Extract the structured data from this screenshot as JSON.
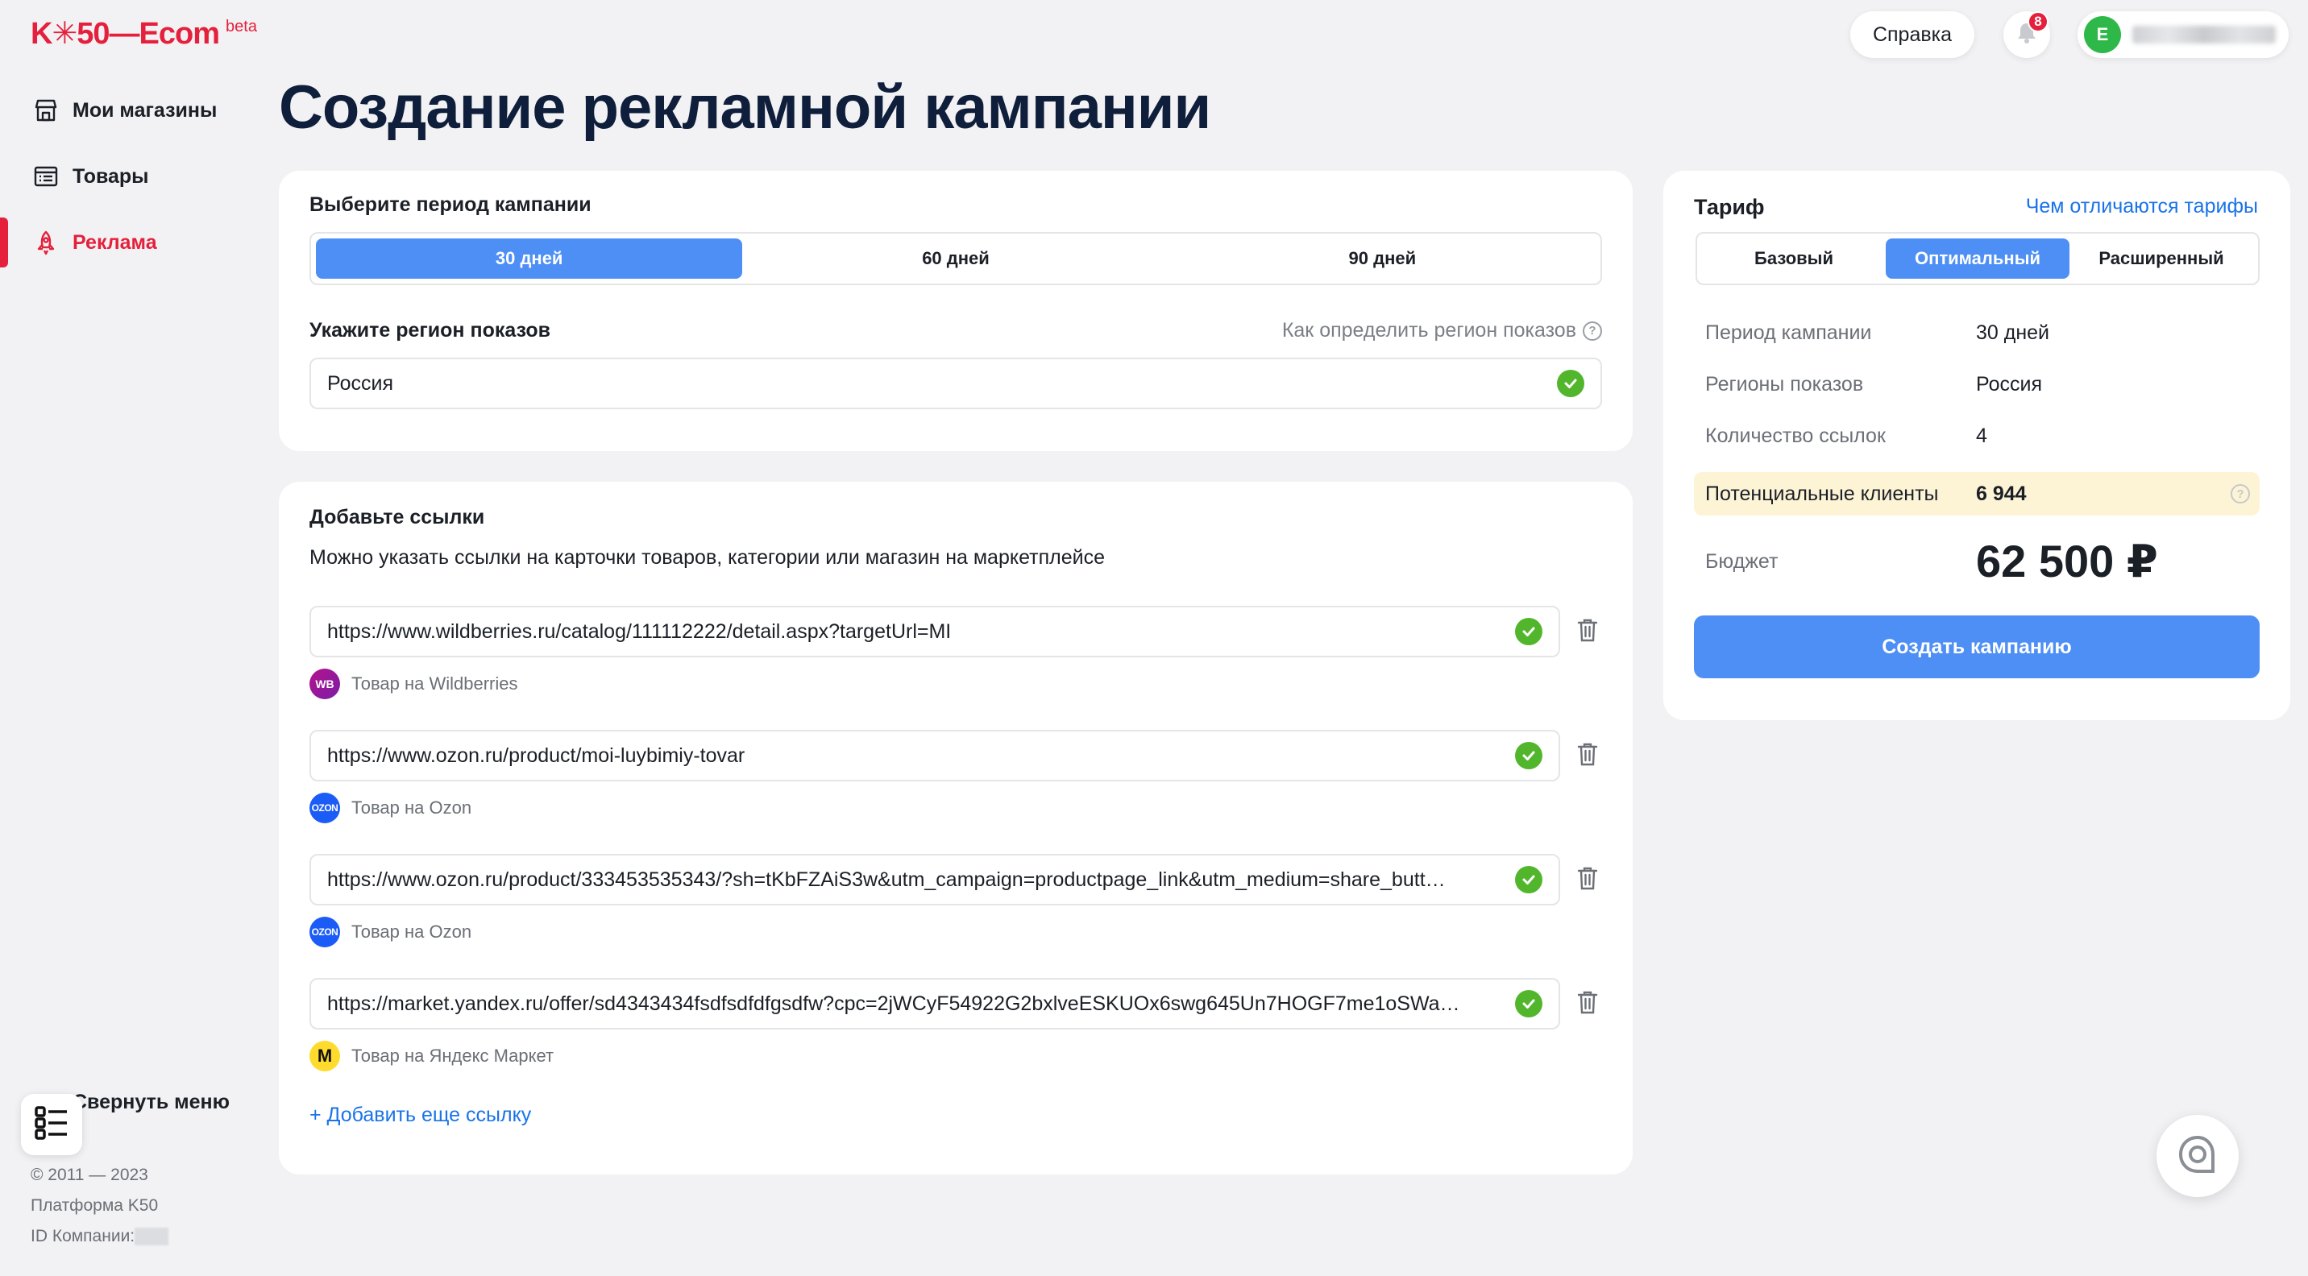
{
  "app": {
    "logo": "K✳50—Ecom",
    "beta": "beta"
  },
  "sidebar": {
    "items": [
      {
        "label": "Мои магазины",
        "icon": "store-icon"
      },
      {
        "label": "Товары",
        "icon": "list-icon"
      },
      {
        "label": "Реклама",
        "icon": "rocket-icon",
        "active": true
      }
    ],
    "collapse_label": "Свернуть меню",
    "footer": {
      "copyright": "© 2011 — 2023",
      "platform": "Платформа K50",
      "company_id_label": "ID Компании:"
    }
  },
  "header": {
    "help_label": "Справка",
    "notifications_count": "8",
    "avatar_letter": "E"
  },
  "page_title": "Создание рекламной кампании",
  "period": {
    "title": "Выберите период кампании",
    "options": [
      "30 дней",
      "60 дней",
      "90 дней"
    ],
    "selected": "30 дней"
  },
  "region": {
    "title": "Укажите регион показов",
    "help_link": "Как определить регион показов",
    "value": "Россия"
  },
  "links": {
    "title": "Добавьте ссылки",
    "description": "Можно указать ссылки на карточки товаров, категории или магазин на маркетплейсе",
    "items": [
      {
        "url": "https://www.wildberries.ru/catalog/111112222/detail.aspx?targetUrl=MI",
        "marketplace": "Товар на Wildberries",
        "logo": "WB"
      },
      {
        "url": "https://www.ozon.ru/product/moi-luybimiy-tovar",
        "marketplace": "Товар на Ozon",
        "logo": "OZON"
      },
      {
        "url": "https://www.ozon.ru/product/333453535343/?sh=tKbFZAiS3w&utm_campaign=productpage_link&utm_medium=share_butt…",
        "marketplace": "Товар на Ozon",
        "logo": "OZON"
      },
      {
        "url": "https://market.yandex.ru/offer/sd4343434fsdfsdfdfgsdfw?cpc=2jWCyF54922G2bxlveESKUOx6swg645Un7HOGF7me1oSWa…",
        "marketplace": "Товар на Яндекс Маркет",
        "logo": "M"
      }
    ],
    "add_label": "+ Добавить еще ссылку"
  },
  "tariff": {
    "title": "Тариф",
    "diff_link": "Чем отличаются тарифы",
    "options": [
      "Базовый",
      "Оптимальный",
      "Расширенный"
    ],
    "selected": "Оптимальный",
    "summary": {
      "period_label": "Период кампании",
      "period_value": "30 дней",
      "regions_label": "Регионы показов",
      "regions_value": "Россия",
      "links_label": "Количество ссылок",
      "links_value": "4",
      "clients_label": "Потенциальные клиенты",
      "clients_value": "6 944",
      "budget_label": "Бюджет",
      "budget_value": "62 500 ₽"
    },
    "create_label": "Создать кампанию"
  },
  "colors": {
    "brand": "#e5203c",
    "accent": "#4d8ff5",
    "link": "#1a73e8",
    "success": "#52b62c",
    "highlight": "#fdf4d6"
  }
}
